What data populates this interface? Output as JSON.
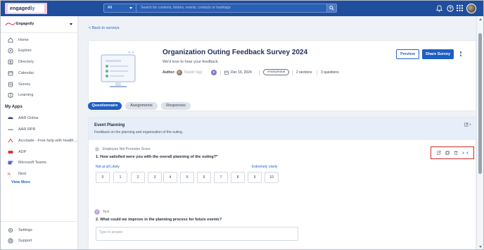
{
  "brand": {
    "logo_text_a": "engaged",
    "logo_text_b": "ly",
    "topbar_color": "#1f4e9c",
    "accent": "#1f5fc4"
  },
  "search": {
    "scope": "All",
    "placeholder": "Search for contents, folders, events, contacts or hashtags"
  },
  "top_icons": [
    "bell-icon",
    "question-icon",
    "apps-grid-icon"
  ],
  "sidebar": {
    "org_name": "Engagedly",
    "items": [
      {
        "label": "Home",
        "icon": "home-icon"
      },
      {
        "label": "Explore",
        "icon": "compass-icon"
      },
      {
        "label": "Directory",
        "icon": "directory-icon"
      },
      {
        "label": "Calendar",
        "icon": "calendar-icon"
      },
      {
        "label": "Survey",
        "icon": "survey-icon"
      },
      {
        "label": "Learning",
        "icon": "learning-icon"
      }
    ],
    "apps_section": "My Apps",
    "apps": [
      {
        "label": "AAR Online",
        "icon": "aar-online-icon"
      },
      {
        "label": "AAR RPR",
        "icon": "aar-rpr-icon"
      },
      {
        "label": "Accolade - Free help with health ...",
        "icon": "accolade-icon"
      },
      {
        "label": "ADP",
        "icon": "adp-icon"
      },
      {
        "label": "Microsoft Teams",
        "icon": "teams-icon"
      },
      {
        "label": "Next",
        "icon": "next-icon"
      }
    ],
    "view_more": "View More",
    "footer": [
      {
        "label": "Settings",
        "icon": "gear-icon"
      },
      {
        "label": "Support",
        "icon": "support-icon"
      }
    ]
  },
  "page": {
    "back": "< Back to surveys",
    "title": "Organization Outing Feedback Survey 2024",
    "subtitle": "We'd love to hear your feedback.",
    "author_label": "Author:",
    "author_name": "Randil Vagi",
    "author_badge": "B",
    "date": "Dec 16, 2024",
    "visibility": "Anonymous",
    "sections": "2 sections",
    "questions": "3 questions",
    "preview": "Preview",
    "share": "Share Survey"
  },
  "tabs": [
    {
      "label": "Questionnaire",
      "active": true
    },
    {
      "label": "Assignments",
      "active": false
    },
    {
      "label": "Responses",
      "active": false
    }
  ],
  "section": {
    "title": "Event Planning",
    "description": "Feedback on the planning and organization of the outing.",
    "edit_count": "1"
  },
  "questions": [
    {
      "type": "Employee Net Promoter Score",
      "text": "1. How satisfied were you with the overall planning of the outing?*",
      "low": "Not at all Likely",
      "high": "Extremely Likely",
      "scale": [
        "0",
        "1",
        "2",
        "3",
        "4",
        "5",
        "6",
        "7",
        "8",
        "9",
        "10"
      ],
      "actions": [
        "edit-icon",
        "copy-icon",
        "delete-icon",
        "collapse-icon"
      ]
    },
    {
      "type": "Text",
      "type_badge": "T",
      "text": "2. What could we improve in the planning process for future events?",
      "placeholder": "Type in answer"
    }
  ]
}
